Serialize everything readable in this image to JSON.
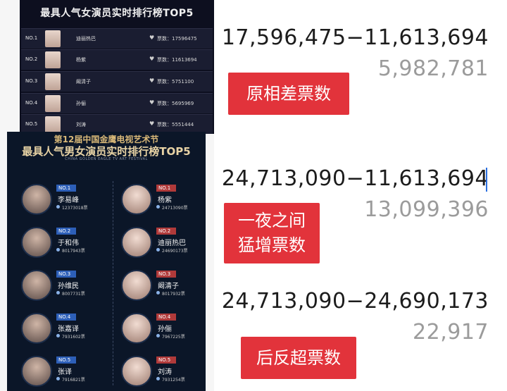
{
  "top_card": {
    "title": "最具人气女演员实时排行榜TOP5",
    "rows": [
      {
        "rank": "NO.1",
        "name": "迪丽热巴",
        "votes": "票数：17596475"
      },
      {
        "rank": "NO.2",
        "name": "杨紫",
        "votes": "票数：11613694"
      },
      {
        "rank": "NO.3",
        "name": "阚清子",
        "votes": "票数：5751100"
      },
      {
        "rank": "NO.4",
        "name": "孙俪",
        "votes": "票数：5695969"
      },
      {
        "rank": "NO.5",
        "name": "刘涛",
        "votes": "票数：5551444"
      }
    ]
  },
  "bottom_card": {
    "title1": "第12届中国金鹰电视艺术节",
    "title2": "最具人气男女演员实时排行榜TOP5",
    "subtitle": "CHINA GOLDEN EAGLE TV ART FESTIVAL",
    "male": [
      {
        "rank": "NO.1",
        "name": "李易峰",
        "votes": "12373018票"
      },
      {
        "rank": "NO.2",
        "name": "于和伟",
        "votes": "8017943票"
      },
      {
        "rank": "NO.3",
        "name": "孙维民",
        "votes": "8007731票"
      },
      {
        "rank": "NO.4",
        "name": "张嘉译",
        "votes": "7931602票"
      },
      {
        "rank": "NO.5",
        "name": "张译",
        "votes": "7916821票"
      }
    ],
    "female": [
      {
        "rank": "NO.1",
        "name": "杨紫",
        "votes": "24713090票"
      },
      {
        "rank": "NO.2",
        "name": "迪丽热巴",
        "votes": "24690173票"
      },
      {
        "rank": "NO.3",
        "name": "阚清子",
        "votes": "8017932票"
      },
      {
        "rank": "NO.4",
        "name": "孙俪",
        "votes": "7967225票"
      },
      {
        "rank": "NO.5",
        "name": "刘涛",
        "votes": "7931254票"
      }
    ]
  },
  "right_panel": {
    "block1": {
      "expr": "17,596,475−11,613,694",
      "result": "5,982,781",
      "tag": "原相差票数"
    },
    "block2": {
      "expr": "24,713,090−11,613,694",
      "result": "13,099,396",
      "tag_line1": "一夜之间",
      "tag_line2": "猛增票数"
    },
    "block3": {
      "expr": "24,713,090−24,690,173",
      "result": "22,917",
      "tag": "后反超票数"
    }
  },
  "colors": {
    "tag_red": "#e2333b",
    "result_gray": "#9b9b9b",
    "dark_navy": "#0b1628"
  }
}
